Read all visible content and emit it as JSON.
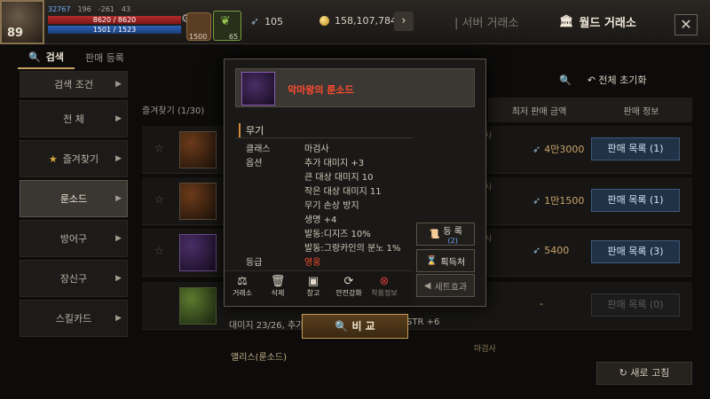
{
  "player": {
    "level": "89",
    "power": "32767",
    "stat2": "196",
    "stat3": "-261",
    "stat4": "43",
    "hp": "8620 / 8620",
    "mp": "1501 / 1523"
  },
  "bag": {
    "count": "1500"
  },
  "leaf": {
    "count": "65"
  },
  "currency": {
    "feather": "105",
    "gold": "158,107,784"
  },
  "nav": {
    "server_tab": "서버 거래소",
    "world_tab": "월드 거래소"
  },
  "tabs": [
    {
      "label": "검색"
    },
    {
      "label": "판매 등록"
    }
  ],
  "sidebar": {
    "header": "검색 조건",
    "items": [
      {
        "label": "전 체"
      },
      {
        "label": "즐겨찾기"
      },
      {
        "label": "룬소드"
      },
      {
        "label": "방어구"
      },
      {
        "label": "장신구"
      },
      {
        "label": "스킬카드"
      }
    ]
  },
  "list": {
    "favorites_title": "즐겨찾기 (1/30)",
    "reset_all": "전체 초기화",
    "col_min_price": "최저 판매 금액",
    "col_sell_info": "판매 정보",
    "rows": [
      {
        "price": "4만3000",
        "button": "판매 목록 (1)"
      },
      {
        "price": "1만1500",
        "button": "판매 목록 (1)"
      },
      {
        "price": "5400",
        "button": "판매 목록 (3)"
      },
      {
        "price": "-",
        "button": "판매 목록 (0)"
      }
    ],
    "row_detail": "대미지 23/26, 추가",
    "row_detail2": "STR +6",
    "bottom_item": "앨리스(룬소드)",
    "side_marks": [
      "사",
      "사",
      "사",
      "마검사"
    ],
    "refresh": "새로 고침"
  },
  "popup": {
    "item_name": "악마왕의 룬소드",
    "type": "무기",
    "class_label": "클래스",
    "class_value": "마검사",
    "option_label": "옵션",
    "options": [
      "추가 대미지 +3",
      "큰 대상 대미지 10",
      "작은 대상 대미지 11",
      "무기 손상 방지",
      "생명 +4",
      "발동:디지즈 10%",
      "발동:그랑카인의 분노 1%"
    ],
    "grade_label": "등급",
    "grade_value": "영웅",
    "register": "등 록",
    "register_sub": "(2)",
    "acquire": "획득처",
    "set_effect": "세트효과",
    "actions": [
      "거래소",
      "삭제",
      "창고",
      "안전강화",
      "착용정보"
    ],
    "compare": "비 교"
  },
  "colors": {
    "grade_hero": "#ff4b2f",
    "sell_button": "#223246"
  }
}
